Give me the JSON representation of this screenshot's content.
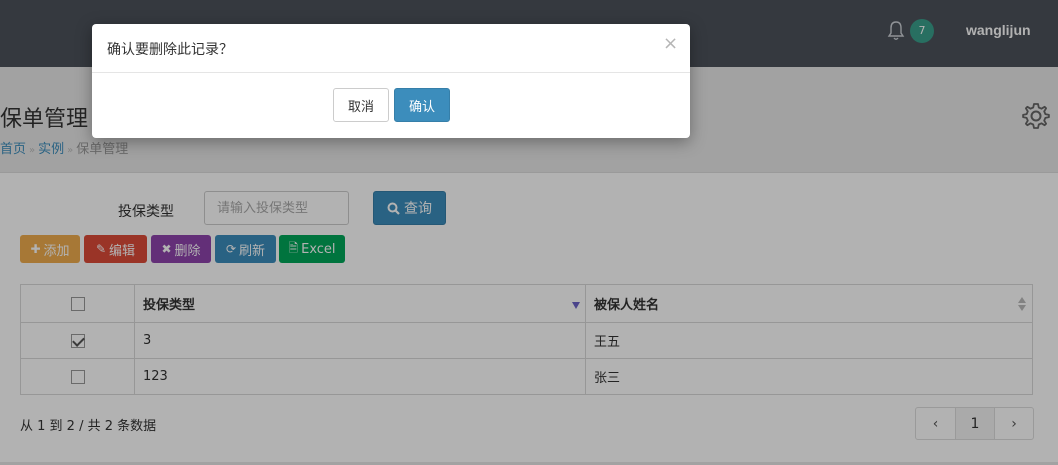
{
  "header": {
    "notification_count": "7",
    "username": "wanglijun"
  },
  "page": {
    "title": "保单管理",
    "breadcrumb": [
      "首页",
      "实例",
      "保单管理"
    ]
  },
  "search": {
    "label": "投保类型",
    "placeholder": "请输入投保类型",
    "query_label": "查询"
  },
  "toolbar": {
    "add": "添加",
    "edit": "编辑",
    "delete": "删除",
    "refresh": "刷新",
    "excel": "Excel"
  },
  "colors": {
    "add": "#f0ad4e",
    "edit": "#dd4b39",
    "delete": "#8e44ad",
    "refresh": "#3c8dbc",
    "excel": "#00a65a"
  },
  "table": {
    "columns": [
      "投保类型",
      "被保人姓名"
    ],
    "rows": [
      {
        "checked": true,
        "type": "3",
        "name": "王五"
      },
      {
        "checked": false,
        "type": "123",
        "name": "张三"
      }
    ]
  },
  "footer": {
    "summary": "从 1 到 2 / 共 2 条数据",
    "prev": "‹",
    "current_page": "1",
    "next": "›"
  },
  "dialog": {
    "message": "确认要删除此记录？",
    "close": "×",
    "cancel": "取消",
    "confirm": "确认"
  }
}
